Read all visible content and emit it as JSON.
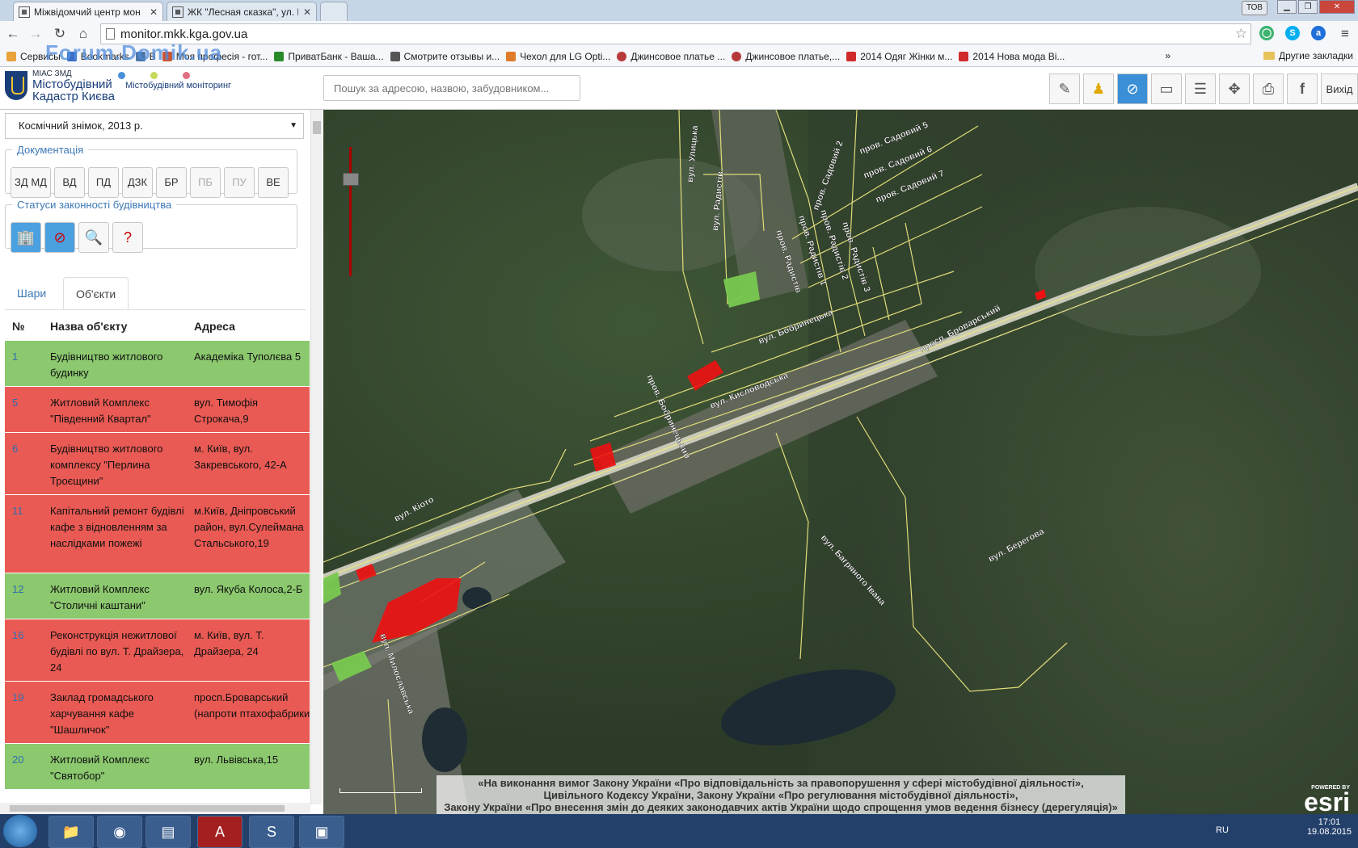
{
  "browser": {
    "tabs": [
      {
        "label": "Міжвідомчий центр мон",
        "active": true
      },
      {
        "label": "ЖК \"Лесная сказка\", ул. Р",
        "active": false
      }
    ],
    "user_badge": "ТОВ",
    "address": "monitor.mkk.kga.gov.ua",
    "bookmarks": [
      {
        "label": "Сервисы",
        "color": "#e8a33c"
      },
      {
        "label": "Bookmarks",
        "color": "#3b6fc6"
      },
      {
        "label": "В",
        "color": "#4a76a8"
      },
      {
        "label": "Моя професія - гот...",
        "color": "#cc5533"
      },
      {
        "label": "ПриватБанк - Ваша...",
        "color": "#2a8a2a"
      },
      {
        "label": "Смотрите отзывы и...",
        "color": "#555555"
      },
      {
        "label": "Чехол для LG Opti...",
        "color": "#e07b2a"
      },
      {
        "label": "Джинсовое платье ...",
        "color": "#b73a3a"
      },
      {
        "label": "Джинсовое платье,...",
        "color": "#b73a3a"
      },
      {
        "label": "2014 Одяг Жінки м...",
        "color": "#d02a2a"
      },
      {
        "label": "2014 Нова мода Ві...",
        "color": "#d02a2a"
      }
    ],
    "bookmarks_more": "»",
    "other_bookmarks": "Другие закладки",
    "watermark": "Forum.Domik.ua"
  },
  "app": {
    "small_title": "МІАС ЗМД",
    "title_line1": "Містобудівний",
    "title_line2": "Кадастр Києва",
    "monitoring_label": "Містобудівний моніторинг",
    "dot_colors": [
      "#4a90d9",
      "#c8d85a",
      "#e07080"
    ],
    "search_placeholder": "Пошук за адресою, назвою, забудовником...",
    "exit_label": "Вихід"
  },
  "panel": {
    "basemap": "Космічний знімок, 2013 р.",
    "documentation_legend": "Документація",
    "doc_buttons": [
      {
        "label": "ЗД МД",
        "disabled": false
      },
      {
        "label": "ВД",
        "disabled": false
      },
      {
        "label": "ПД",
        "disabled": false
      },
      {
        "label": "ДЗК",
        "disabled": false
      },
      {
        "label": "БР",
        "disabled": false
      },
      {
        "label": "ПБ",
        "disabled": true
      },
      {
        "label": "ПУ",
        "disabled": true
      },
      {
        "label": "ВЕ",
        "disabled": false
      }
    ],
    "status_legend": "Статуси законності будівництва",
    "tabs": {
      "layers": "Шари",
      "objects": "Об'єкти"
    },
    "table_headers": {
      "num": "№",
      "name": "Назва об'єкту",
      "address": "Адреса"
    },
    "rows": [
      {
        "num": "1",
        "name": "Будівництво житлового будинку",
        "address": "Академіка Туполєва 5",
        "status": "green"
      },
      {
        "num": "5",
        "name": "Житловий Комплекс \"Південний Квартал\"",
        "address": "вул. Тимофія Строкача,9",
        "status": "red"
      },
      {
        "num": "6",
        "name": "Будівництво житлового комплексу \"Перлина Троєщини\"",
        "address": "м. Київ, вул. Закревського, 42-А",
        "status": "red"
      },
      {
        "num": "11",
        "name": "Капітальний ремонт будівлі кафе з відновленням за наслідками пожежі",
        "address": "м.Київ, Дніпровський район, вул.Сулеймана Стальського,19",
        "status": "red"
      },
      {
        "num": "12",
        "name": "Житловий Комплекс \"Столичні каштани\"",
        "address": "вул. Якуба Колоса,2-Б",
        "status": "green"
      },
      {
        "num": "16",
        "name": "Реконструкція нежитлової будівлі по вул. Т. Драйзера, 24",
        "address": "м. Київ, вул. Т. Драйзера, 24",
        "status": "red"
      },
      {
        "num": "19",
        "name": "Заклад громадського харчування кафе \"Шашличок\"",
        "address": "просп.Броварський (напроти птахофабрики)",
        "status": "red"
      },
      {
        "num": "20",
        "name": "Житловий Комплекс \"Святобор\"",
        "address": "вул. Львівська,15",
        "status": "green"
      }
    ]
  },
  "map": {
    "street_labels": [
      {
        "text": "вул. Улицька"
      },
      {
        "text": "вул. Радистів"
      },
      {
        "text": "пров. Садовий 5"
      },
      {
        "text": "пров. Садовий 6"
      },
      {
        "text": "пров. Садовий 7"
      },
      {
        "text": "пров. Садовий 2"
      },
      {
        "text": "пров. Радистів"
      },
      {
        "text": "пров. Радистів 1"
      },
      {
        "text": "пров. Радистів 2"
      },
      {
        "text": "пров. Радистів 3"
      },
      {
        "text": "вул. Бобринецька"
      },
      {
        "text": "вул. Кисловодська"
      },
      {
        "text": "просп. Броварський"
      },
      {
        "text": "пров. Бобринецький"
      },
      {
        "text": "вул. Кіото"
      },
      {
        "text": "вул. Берегова"
      },
      {
        "text": "вул. Багряного Івана"
      },
      {
        "text": "вул. Милославська"
      }
    ],
    "notice": [
      "«На виконання вимог Закону України «Про відповідальність за правопорушення у сфері містобудівної діяльності»,",
      "Цивільного Кодексу України, Закону України «Про регулювання містобудівної діяльності»,",
      "Закону України «Про внесення змін до деяких законодавчих актів України щодо спрощення умов ведення бізнесу (дерегуляція)»"
    ],
    "esri_powered": "POWERED BY",
    "esri_name": "esri"
  },
  "taskbar": {
    "lang": "RU",
    "time": "17:01",
    "date": "19.08.2015"
  }
}
